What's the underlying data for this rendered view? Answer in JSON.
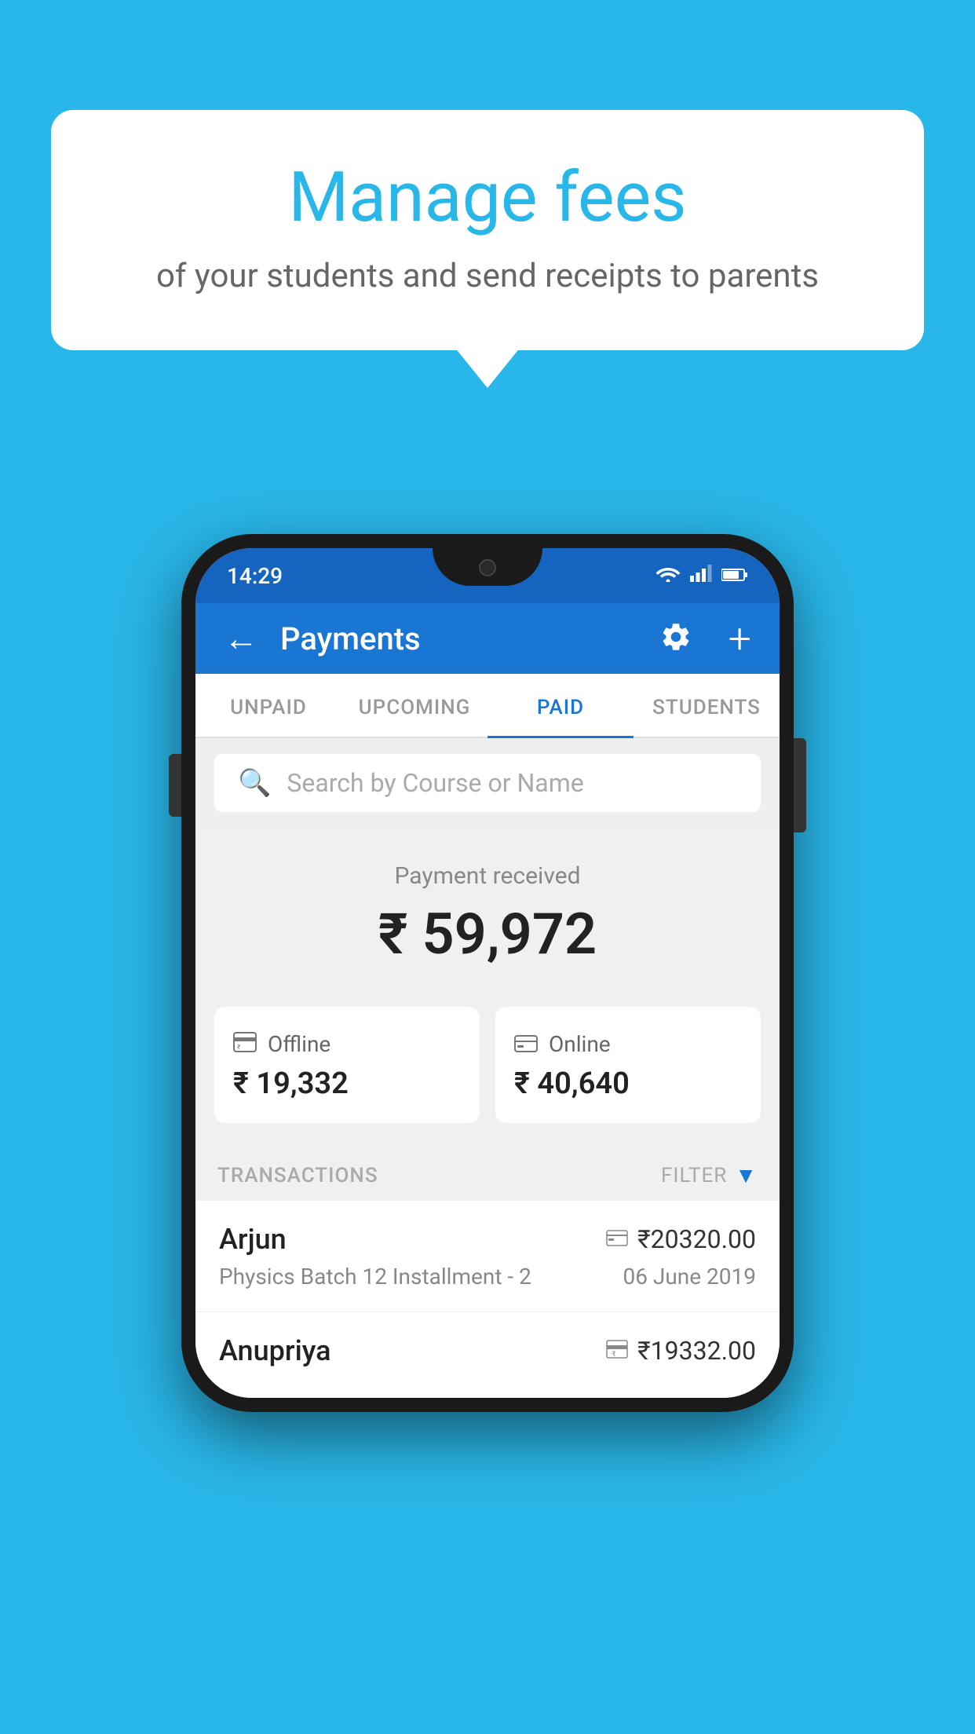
{
  "background_color": "#29b6e8",
  "speech_bubble": {
    "title": "Manage fees",
    "subtitle": "of your students and send receipts to parents"
  },
  "status_bar": {
    "time": "14:29",
    "icons": [
      "wifi",
      "signal",
      "battery"
    ]
  },
  "app_bar": {
    "back_icon": "←",
    "title": "Payments",
    "settings_icon": "⚙",
    "add_icon": "+"
  },
  "tabs": [
    {
      "label": "UNPAID",
      "active": false
    },
    {
      "label": "UPCOMING",
      "active": false
    },
    {
      "label": "PAID",
      "active": true
    },
    {
      "label": "STUDENTS",
      "active": false
    }
  ],
  "search": {
    "placeholder": "Search by Course or Name"
  },
  "payment_received": {
    "label": "Payment received",
    "amount": "₹ 59,972"
  },
  "payment_cards": [
    {
      "icon": "offline",
      "label": "Offline",
      "amount": "₹ 19,332"
    },
    {
      "icon": "online",
      "label": "Online",
      "amount": "₹ 40,640"
    }
  ],
  "transactions_section": {
    "label": "TRANSACTIONS",
    "filter_label": "FILTER"
  },
  "transactions": [
    {
      "name": "Arjun",
      "course": "Physics Batch 12 Installment - 2",
      "amount": "₹20320.00",
      "date": "06 June 2019",
      "type": "online"
    },
    {
      "name": "Anupriya",
      "course": "",
      "amount": "₹19332.00",
      "date": "",
      "type": "offline"
    }
  ]
}
